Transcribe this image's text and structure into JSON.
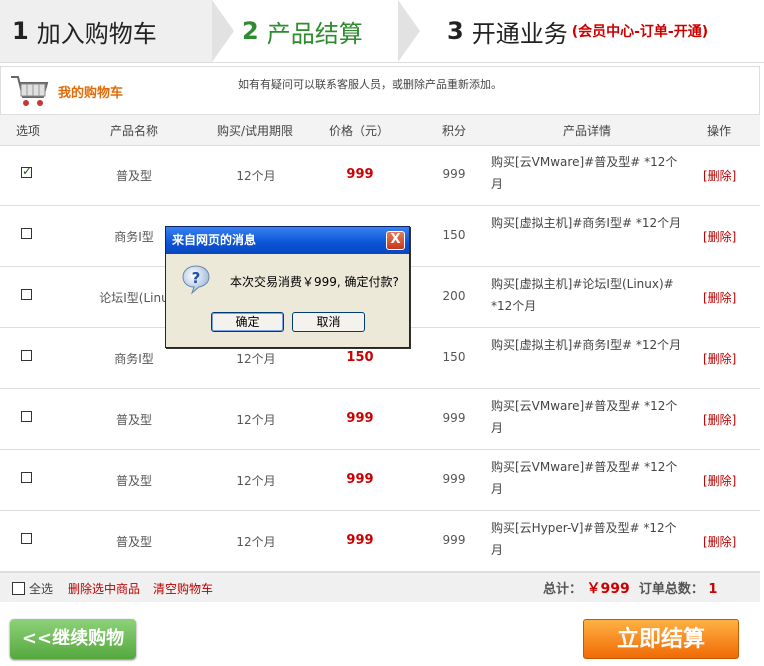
{
  "steps": [
    {
      "num": "1",
      "label": "加入购物车"
    },
    {
      "num": "2",
      "label": "产品结算"
    },
    {
      "num": "3",
      "label": "开通业务",
      "note": "(会员中心-订单-开通)"
    }
  ],
  "cart": {
    "title": "我的购物车",
    "tip": "如有有疑问可以联系客服人员，或删除产品重新添加。"
  },
  "table": {
    "headers": [
      "选项",
      "产品名称",
      "购买/试用期限",
      "价格（元）",
      "积分",
      "产品详情",
      "操作"
    ],
    "rows": [
      {
        "checked": true,
        "name": "普及型",
        "period": "12个月",
        "price": "999",
        "points": "999",
        "detail": "购买[云VMware]#普及型# *12个月",
        "action": "[删除]"
      },
      {
        "checked": false,
        "name": "商务I型",
        "period": "",
        "price": "",
        "points": "150",
        "detail": "购买[虚拟主机]#商务I型# *12个月",
        "action": "[删除]"
      },
      {
        "checked": false,
        "name": "论坛I型(Linu",
        "period": "",
        "price": "",
        "points": "200",
        "detail": "购买[虚拟主机]#论坛I型(Linux)# *12个月",
        "action": "[删除]"
      },
      {
        "checked": false,
        "name": "商务I型",
        "period": "12个月",
        "price": "150",
        "points": "150",
        "detail": "购买[虚拟主机]#商务I型# *12个月",
        "action": "[删除]"
      },
      {
        "checked": false,
        "name": "普及型",
        "period": "12个月",
        "price": "999",
        "points": "999",
        "detail": "购买[云VMware]#普及型# *12个月",
        "action": "[删除]"
      },
      {
        "checked": false,
        "name": "普及型",
        "period": "12个月",
        "price": "999",
        "points": "999",
        "detail": "购买[云VMware]#普及型# *12个月",
        "action": "[删除]"
      },
      {
        "checked": false,
        "name": "普及型",
        "period": "12个月",
        "price": "999",
        "points": "999",
        "detail": "购买[云Hyper-V]#普及型# *12个月",
        "action": "[删除]"
      }
    ]
  },
  "footer": {
    "select_all": "全选",
    "delete_selected": "删除选中商品",
    "clear_cart": "清空购物车",
    "total_label": "总计：",
    "total_amount": "￥999",
    "count_label": "订单总数：",
    "count_value": "1"
  },
  "buttons": {
    "continue": "<<继续购物",
    "checkout": "立即结算"
  },
  "dialog": {
    "title": "来自网页的消息",
    "message": "本次交易消费￥999, 确定付款?",
    "ok": "确定",
    "cancel": "取消",
    "close": "X"
  }
}
